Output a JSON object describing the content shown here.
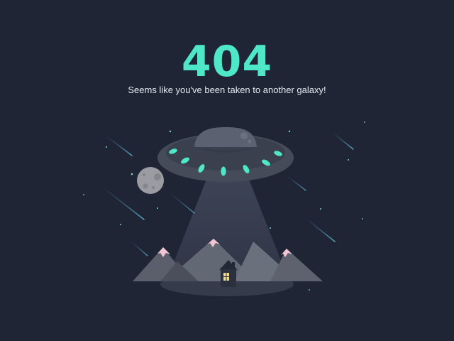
{
  "error": {
    "code": "404",
    "message": "Seems like you've been taken to another galaxy!"
  },
  "colors": {
    "background": "#1f2535",
    "accent": "#4ee8c9",
    "text": "#e6e9ef",
    "ufo_body": "#454b59",
    "ufo_dome": "#5b6170",
    "mountain": "#5a5f6b",
    "snow": "#f3c6d3"
  },
  "icons": [
    "ufo-icon",
    "moon-icon",
    "house-icon",
    "mountain-icon",
    "shooting-star-icon"
  ]
}
